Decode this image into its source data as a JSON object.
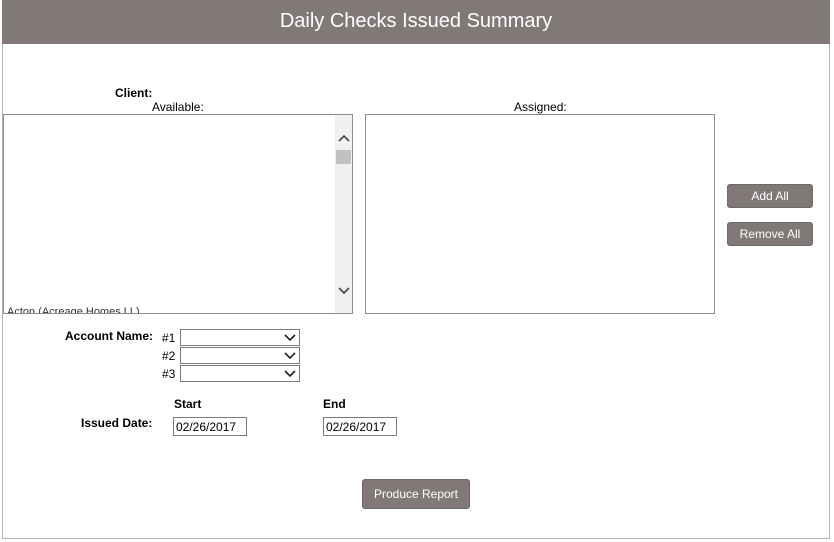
{
  "header": {
    "title": "Daily Checks Issued Summary"
  },
  "client": {
    "label": "Client:",
    "available_label": "Available:",
    "assigned_label": "Assigned:",
    "available_cutoff_text": "Acton (Acreage Homes LL)"
  },
  "buttons": {
    "add_all": "Add All",
    "remove_all": "Remove All",
    "produce_report": "Produce Report"
  },
  "account": {
    "label": "Account Name:",
    "selects": [
      {
        "label": "#1",
        "value": ""
      },
      {
        "label": "#2",
        "value": ""
      },
      {
        "label": "#3",
        "value": ""
      }
    ]
  },
  "issued_date": {
    "label": "Issued Date:",
    "start_label": "Start",
    "end_label": "End",
    "start_value": "02/26/2017",
    "end_value": "02/26/2017"
  },
  "icons": {
    "scroll_up": "chevron-up-icon",
    "scroll_down": "chevron-down-icon",
    "select_arrow": "chevron-down-icon"
  },
  "colors": {
    "header_bg": "#807977",
    "button_bg": "#807977"
  }
}
